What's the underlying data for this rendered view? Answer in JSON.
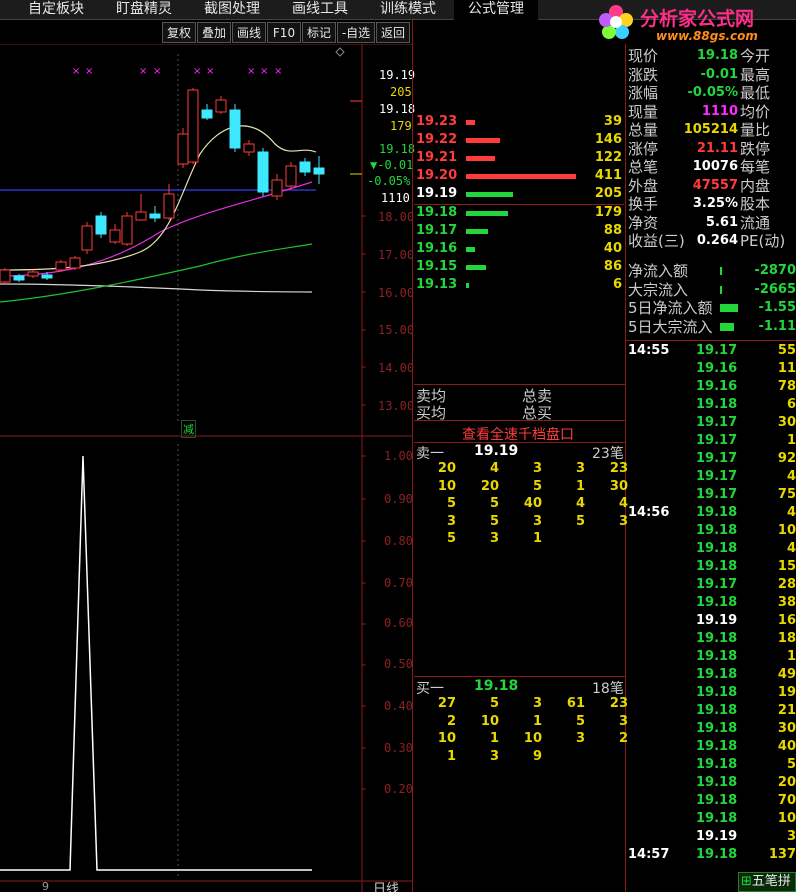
{
  "menu": [
    "自定板块",
    "盯盘精灵",
    "截图处理",
    "画线工具",
    "训练模式",
    "公式管理"
  ],
  "toolbar": [
    "复权",
    "叠加",
    "画线",
    "F10",
    "标记",
    "-自选",
    "返回"
  ],
  "watermark": {
    "brand": "分析家公式网",
    "url": "www.88gs.com"
  },
  "kline": {
    "overlay_labels": [
      "19.19",
      "205",
      "19.18",
      "179",
      "19.18",
      "▼-0.01",
      "-0.05%",
      "1110"
    ],
    "price_axis": [
      "18.00",
      "17.00",
      "16.00",
      "15.00",
      "14.00",
      "13.00"
    ],
    "marker": "减",
    "sub_axis": [
      "1.00",
      "0.90",
      "0.80",
      "0.70",
      "0.60",
      "0.50",
      "0.40",
      "0.30",
      "0.20"
    ],
    "bottom_left": "9",
    "bottom_right": "日线"
  },
  "orderbook": {
    "asks": [
      {
        "price": "19.23",
        "vol": "39",
        "bar": 0.1
      },
      {
        "price": "19.22",
        "vol": "146",
        "bar": 0.37
      },
      {
        "price": "19.21",
        "vol": "122",
        "bar": 0.31
      },
      {
        "price": "19.20",
        "vol": "411",
        "bar": 1.0
      }
    ],
    "current": {
      "price": "19.19",
      "vol": "205",
      "bar": 0.52
    },
    "bids": [
      {
        "price": "19.18",
        "vol": "179",
        "bar": 0.45
      },
      {
        "price": "19.17",
        "vol": "88",
        "bar": 0.22
      },
      {
        "price": "19.16",
        "vol": "40",
        "bar": 0.1
      },
      {
        "price": "19.15",
        "vol": "86",
        "bar": 0.22
      },
      {
        "price": "19.13",
        "vol": "6",
        "bar": 0.03
      }
    ],
    "sell_avg_label": "卖均",
    "buy_avg_label": "买均",
    "total_sell_label": "总卖",
    "total_buy_label": "总买",
    "link": "查看全速千档盘口",
    "sell1": {
      "label": "卖一",
      "price": "19.19",
      "count": "23笔",
      "rows": [
        [
          "20",
          "4",
          "3",
          "3",
          "23"
        ],
        [
          "10",
          "20",
          "5",
          "1",
          "30"
        ],
        [
          "5",
          "5",
          "40",
          "4",
          "4"
        ],
        [
          "3",
          "5",
          "3",
          "5",
          "3"
        ],
        [
          "5",
          "3",
          "1",
          "",
          ""
        ]
      ]
    },
    "buy1": {
      "label": "买一",
      "price": "19.18",
      "count": "18笔",
      "rows": [
        [
          "27",
          "5",
          "3",
          "61",
          "23"
        ],
        [
          "2",
          "10",
          "1",
          "5",
          "3"
        ],
        [
          "10",
          "1",
          "10",
          "3",
          "2"
        ],
        [
          "1",
          "3",
          "9",
          "",
          ""
        ]
      ]
    }
  },
  "info": {
    "rows": [
      {
        "label": "现价",
        "value": "19.18",
        "label2": "今开",
        "color": "green"
      },
      {
        "label": "涨跌",
        "value": "-0.01",
        "label2": "最高",
        "color": "green"
      },
      {
        "label": "涨幅",
        "value": "-0.05%",
        "label2": "最低",
        "color": "green"
      },
      {
        "label": "现量",
        "value": "1110",
        "label2": "均价",
        "color": "magenta"
      },
      {
        "label": "总量",
        "value": "105214",
        "label2": "量比",
        "color": "yellow"
      },
      {
        "label": "涨停",
        "value": "21.11",
        "label2": "跌停",
        "color": "red"
      },
      {
        "label": "总笔",
        "value": "10076",
        "label2": "每笔",
        "color": "white"
      },
      {
        "label": "外盘",
        "value": "47557",
        "label2": "内盘",
        "color": "red"
      },
      {
        "label": "换手",
        "value": "3.25%",
        "label2": "股本",
        "color": "white"
      },
      {
        "label": "净资",
        "value": "5.61",
        "label2": "流通",
        "color": "white"
      },
      {
        "label": "收益(三)",
        "value": "0.264",
        "label2": "PE(动)",
        "color": "white"
      }
    ],
    "flows": [
      {
        "label": "净流入额",
        "value": "-2870",
        "bar": 0.05
      },
      {
        "label": "大宗流入",
        "value": "-2665",
        "bar": 0.05
      },
      {
        "label": "5日净流入额",
        "value": "-1.55",
        "bar": 0.6
      },
      {
        "label": "5日大宗流入",
        "value": "-1.11",
        "bar": 0.45
      }
    ]
  },
  "ticks": [
    {
      "time": "14:55",
      "price": "19.17",
      "vol": "55"
    },
    {
      "time": "",
      "price": "19.16",
      "vol": "11"
    },
    {
      "time": "",
      "price": "19.16",
      "vol": "78"
    },
    {
      "time": "",
      "price": "19.18",
      "vol": "6"
    },
    {
      "time": "",
      "price": "19.17",
      "vol": "30"
    },
    {
      "time": "",
      "price": "19.17",
      "vol": "1"
    },
    {
      "time": "",
      "price": "19.17",
      "vol": "92"
    },
    {
      "time": "",
      "price": "19.17",
      "vol": "4"
    },
    {
      "time": "",
      "price": "19.17",
      "vol": "75"
    },
    {
      "time": "14:56",
      "price": "19.18",
      "vol": "4"
    },
    {
      "time": "",
      "price": "19.18",
      "vol": "10"
    },
    {
      "time": "",
      "price": "19.18",
      "vol": "4"
    },
    {
      "time": "",
      "price": "19.18",
      "vol": "15"
    },
    {
      "time": "",
      "price": "19.17",
      "vol": "28"
    },
    {
      "time": "",
      "price": "19.18",
      "vol": "38"
    },
    {
      "time": "",
      "price": "19.19",
      "vol": "16"
    },
    {
      "time": "",
      "price": "19.18",
      "vol": "18"
    },
    {
      "time": "",
      "price": "19.18",
      "vol": "1"
    },
    {
      "time": "",
      "price": "19.18",
      "vol": "49"
    },
    {
      "time": "",
      "price": "19.18",
      "vol": "19"
    },
    {
      "time": "",
      "price": "19.18",
      "vol": "21"
    },
    {
      "time": "",
      "price": "19.18",
      "vol": "30"
    },
    {
      "time": "",
      "price": "19.18",
      "vol": "40"
    },
    {
      "time": "",
      "price": "19.18",
      "vol": "5"
    },
    {
      "time": "",
      "price": "19.18",
      "vol": "20"
    },
    {
      "time": "",
      "price": "19.18",
      "vol": "70"
    },
    {
      "time": "",
      "price": "19.18",
      "vol": "10"
    },
    {
      "time": "",
      "price": "19.19",
      "vol": "3"
    },
    {
      "time": "14:57",
      "price": "19.18",
      "vol": "137"
    }
  ],
  "corner_button": "五笔拼"
}
